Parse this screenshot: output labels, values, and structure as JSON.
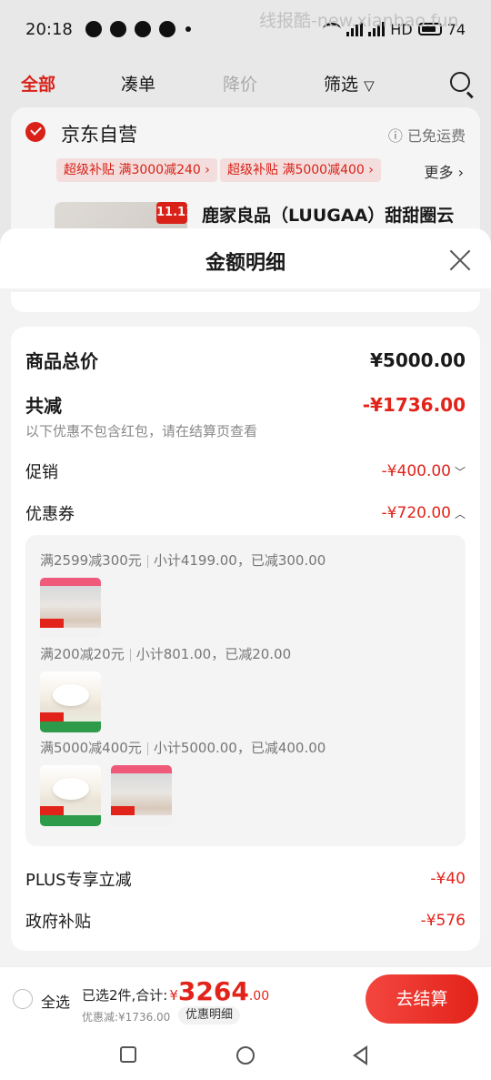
{
  "status_bar": {
    "time": "20:18",
    "battery": "74",
    "network": "HD",
    "watermark": "线报酷-new.xianbao.fun"
  },
  "tabs": [
    {
      "label": "全部",
      "state": "active"
    },
    {
      "label": "凑单",
      "state": "normal"
    },
    {
      "label": "降价",
      "state": "disabled"
    },
    {
      "label": "筛选",
      "state": "normal"
    }
  ],
  "store": {
    "name": "京东自营",
    "shipping": "已免运费",
    "promos": [
      "超级补贴  满3000减240 ›",
      "超级补贴  满5000减400 ›"
    ],
    "more": "更多 ›",
    "product_badge": "11.11",
    "product_title": "鹿家良品（LUUGAA）甜甜圈云"
  },
  "sheet": {
    "title": "金额明细",
    "total_label": "商品总价",
    "total_value": "¥5000.00",
    "discount_label": "共减",
    "discount_value": "-¥1736.00",
    "discount_note": "以下优惠不包含红包，请在结算页查看",
    "promo_label": "促销",
    "promo_value": "-¥400.00",
    "coupon_label": "优惠券",
    "coupon_value": "-¥720.00",
    "coupons": [
      {
        "rule": "满2599减300元",
        "detail": "小计4199.00，已减300.00"
      },
      {
        "rule": "满200减20元",
        "detail": "小计801.00，已减20.00"
      },
      {
        "rule": "满5000减400元",
        "detail": "小计5000.00，已减400.00"
      }
    ],
    "plus_label": "PLUS专享立减",
    "plus_value": "-¥40",
    "gov_label": "政府补贴",
    "gov_value": "-¥576"
  },
  "bottom_bar": {
    "select_all": "全选",
    "summary_label": "已选2件,合计:",
    "currency": "¥",
    "total_int": "3264",
    "total_dec": ".00",
    "saved": "优惠减:¥1736.00",
    "detail_chip": "优惠明细",
    "checkout": "去结算"
  },
  "colors": {
    "accent": "#e2231a",
    "promo_bg": "#fde8e6",
    "sheet_bg": "#f3f3f3"
  }
}
